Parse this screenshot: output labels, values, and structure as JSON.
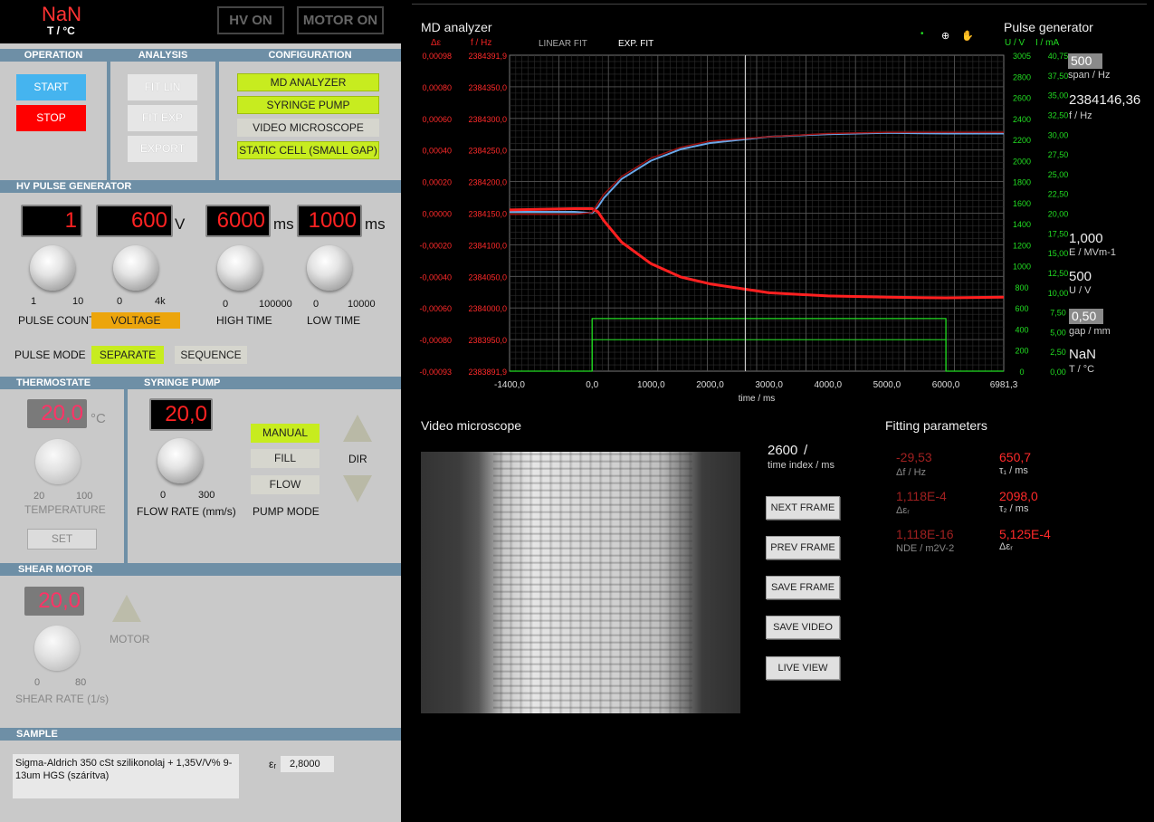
{
  "header": {
    "nan_value": "NaN",
    "nan_unit": "T / °C",
    "hv_on": "HV ON",
    "motor_on": "MOTOR ON"
  },
  "operation": {
    "title": "OPERATION",
    "start": "START",
    "stop": "STOP"
  },
  "analysis": {
    "title": "ANALYSIS",
    "fit_lin": "FIT LIN",
    "fit_exp": "FIT EXP",
    "export": "EXPORT"
  },
  "configuration": {
    "title": "CONFIGURATION",
    "items": [
      "MD ANALYZER",
      "SYRINGE PUMP",
      "VIDEO MICROSCOPE",
      "STATIC CELL (SMALL GAP)"
    ]
  },
  "hv_pulse": {
    "title": "HV PULSE GENERATOR",
    "pulse_count": {
      "value": "1",
      "min": "1",
      "max": "10",
      "label": "PULSE COUNT"
    },
    "voltage": {
      "value": "600",
      "unit": "V",
      "min": "0",
      "max": "4k",
      "label": "VOLTAGE"
    },
    "high_time": {
      "value": "6000",
      "unit": "ms",
      "min": "0",
      "max": "100000",
      "label": "HIGH TIME"
    },
    "low_time": {
      "value": "1000",
      "unit": "ms",
      "min": "0",
      "max": "10000",
      "label": "LOW TIME"
    },
    "pulse_mode_label": "PULSE MODE",
    "separate": "SEPARATE",
    "sequence": "SEQUENCE"
  },
  "thermostate": {
    "title": "THERMOSTATE",
    "value": "20,0",
    "unit": "°C",
    "min": "20",
    "max": "100",
    "label": "TEMPERATURE",
    "set": "SET"
  },
  "syringe_pump": {
    "title": "SYRINGE PUMP",
    "value": "20,0",
    "min": "0",
    "max": "300",
    "label": "FLOW RATE (mm/s)",
    "modes": [
      "MANUAL",
      "FILL",
      "FLOW"
    ],
    "mode_label": "PUMP MODE",
    "dir_label": "DIR"
  },
  "shear_motor": {
    "title": "SHEAR MOTOR",
    "value": "20,0",
    "min": "0",
    "max": "80",
    "label": "SHEAR RATE (1/s)",
    "motor_label": "MOTOR"
  },
  "sample": {
    "title": "SAMPLE",
    "description": "Sigma-Aldrich 350 cSt szilikonolaj + 1,35V/V% 9-13um HGS (szárítva)",
    "eps_label": "εᵣ",
    "eps_value": "2,8000"
  },
  "md_analyzer": {
    "title": "MD analyzer",
    "axis_de": "Δε",
    "axis_f": "f / Hz",
    "linear_fit": "LINEAR FIT",
    "exp_fit": "EXP. FIT",
    "axis_u": "U / V",
    "axis_i": "I / mA",
    "xlabel": "time / ms",
    "colors": {
      "red": "#ff2020",
      "blue": "#6aa8e8",
      "darkred": "#9a1010",
      "green": "#22dd22"
    }
  },
  "pulse_generator": {
    "title": "Pulse generator",
    "span_value": "500",
    "span_unit": "span / Hz",
    "freq_value": "2384146,36",
    "freq_unit": "f / Hz",
    "e_value": "1,000",
    "e_unit": "E / MVm-1",
    "u_value": "500",
    "u_unit": "U / V",
    "gap_value": "0,50",
    "gap_unit": "gap / mm",
    "t_value": "NaN",
    "t_unit": "T / °C"
  },
  "video_microscope": {
    "title": "Video microscope",
    "time_index_value": "2600",
    "time_index_slash": "/",
    "time_index_unit": "time index / ms",
    "buttons": [
      "NEXT FRAME",
      "PREV FRAME",
      "SAVE FRAME",
      "SAVE VIDEO",
      "LIVE VIEW"
    ]
  },
  "fitting": {
    "title": "Fitting parameters",
    "params": [
      {
        "value": "-29,53",
        "unit": "Δf / Hz"
      },
      {
        "value": "650,7",
        "unit": "τ₁ / ms"
      },
      {
        "value": "1,118E-4",
        "unit": "Δεᵣ"
      },
      {
        "value": "2098,0",
        "unit": "τ₂ / ms"
      },
      {
        "value": "1,118E-16",
        "unit": "NDE / m2V-2"
      },
      {
        "value": "5,125E-4",
        "unit": "Δεᵣ"
      }
    ]
  },
  "chart_data": {
    "type": "line",
    "title": "MD analyzer",
    "xlabel": "time / ms",
    "x_ticks": [
      "-1400,0",
      "0,0",
      "1000,0",
      "2000,0",
      "3000,0",
      "4000,0",
      "5000,0",
      "6000,0",
      "6981,3"
    ],
    "xlim": [
      -1400,
      6981.3
    ],
    "y_de_ticks": [
      "0,00098",
      "0,00080",
      "0,00060",
      "0,00040",
      "0,00020",
      "0,00000",
      "-0,00020",
      "-0,00040",
      "-0,00060",
      "-0,00080",
      "-0,00093"
    ],
    "y_de_lim": [
      -0.00093,
      0.00098
    ],
    "y_f_ticks": [
      "2384391,9",
      "2384350,0",
      "2384300,0",
      "2384250,0",
      "2384200,0",
      "2384150,0",
      "2384100,0",
      "2384050,0",
      "2384000,0",
      "2383950,0",
      "2383891,9"
    ],
    "y_f_lim": [
      2383891.9,
      2384391.9
    ],
    "y_u_ticks": [
      "3005",
      "2800",
      "2600",
      "2400",
      "2200",
      "2000",
      "1800",
      "1600",
      "1400",
      "1200",
      "1000",
      "800",
      "600",
      "400",
      "200",
      "0"
    ],
    "y_u_lim": [
      0,
      3005
    ],
    "y_i_ticks": [
      "40,75",
      "37,50",
      "35,00",
      "32,50",
      "30,00",
      "27,50",
      "25,00",
      "22,50",
      "20,00",
      "17,50",
      "15,00",
      "12,50",
      "10,00",
      "7,50",
      "5,00",
      "2,50",
      "0,00"
    ],
    "y_i_lim": [
      0,
      40.75
    ],
    "cursor_x": 2600,
    "grid": true,
    "series": [
      {
        "axis": "f",
        "x": [
          -1400,
          -300,
          0,
          100,
          200,
          500,
          1000,
          1500,
          2000,
          3000,
          4000,
          5000,
          6000,
          6981
        ],
        "y": [
          2384144,
          2384144,
          2384142,
          2384152,
          2384166,
          2384196,
          2384225,
          2384243,
          2384253,
          2384263,
          2384267,
          2384269,
          2384268,
          2384268
        ]
      },
      {
        "axis": "f",
        "x": [
          -1400,
          -300,
          0,
          100,
          200,
          500,
          1000,
          1500,
          2000,
          3000,
          4000,
          5000,
          6000,
          6981
        ],
        "y": [
          2384147,
          2384149,
          2384149,
          2384144,
          2384130,
          2384096,
          2384062,
          2384041,
          2384030,
          2384016,
          2384011,
          2384009,
          2384008,
          2384009
        ]
      },
      {
        "axis": "f",
        "x": [
          -1400,
          -300,
          0,
          100,
          200,
          500,
          1000,
          1500,
          2000,
          3000,
          4000,
          5000,
          6000,
          6981
        ],
        "y": [
          2384140,
          2384140,
          2384143,
          2384158,
          2384172,
          2384200,
          2384229,
          2384246,
          2384256,
          2384263,
          2384268,
          2384270,
          2384270,
          2384270
        ]
      },
      {
        "axis": "u",
        "x": [
          -1400,
          0,
          0,
          6000,
          6000,
          6981
        ],
        "y": [
          0,
          0,
          500,
          500,
          0,
          0
        ]
      },
      {
        "axis": "u",
        "x": [
          -1400,
          0,
          0,
          6000,
          6000,
          6981
        ],
        "y": [
          0,
          0,
          300,
          300,
          0,
          0
        ]
      }
    ]
  }
}
